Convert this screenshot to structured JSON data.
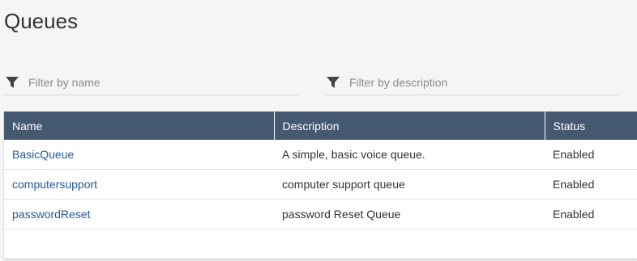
{
  "page": {
    "title": "Queues"
  },
  "filters": {
    "name_placeholder": "Filter by name",
    "description_placeholder": "Filter by description",
    "icon": "filter-icon"
  },
  "table": {
    "columns": [
      "Name",
      "Description",
      "Status"
    ],
    "rows": [
      {
        "name": "BasicQueue",
        "description": "A simple, basic voice queue.",
        "status": "Enabled"
      },
      {
        "name": "computersupport",
        "description": "computer support queue",
        "status": "Enabled"
      },
      {
        "name": "passwordReset",
        "description": "password Reset Queue",
        "status": "Enabled"
      }
    ]
  },
  "colors": {
    "header_bg": "#455a70",
    "link": "#1f5a9b",
    "page_bg": "#f5f5f5"
  }
}
